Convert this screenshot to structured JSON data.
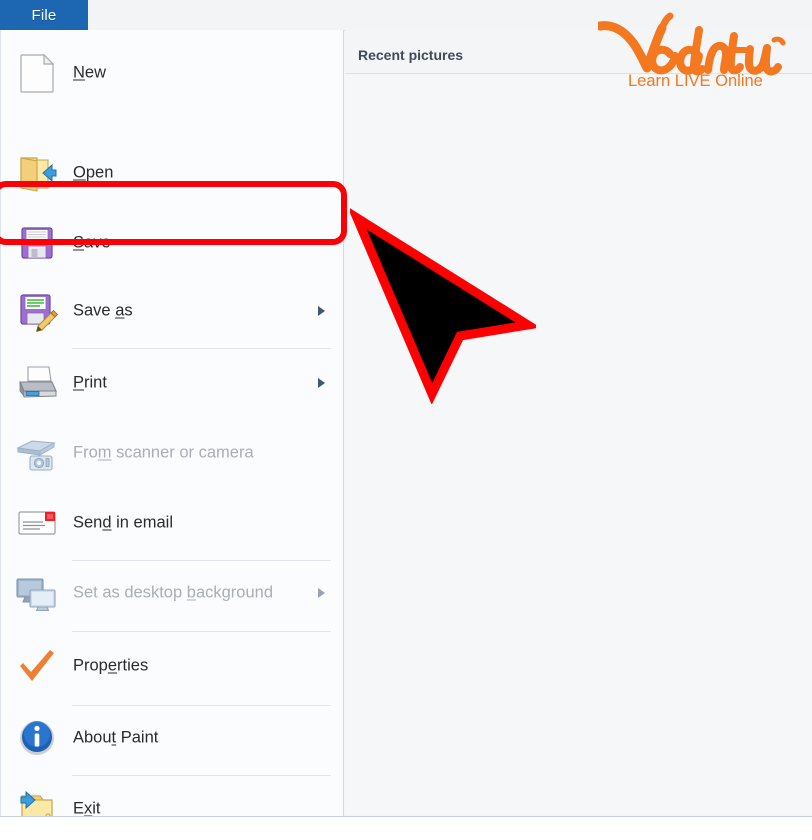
{
  "window": {
    "app_name": "Paint",
    "file_tab_label": "File"
  },
  "file_menu": {
    "items": [
      {
        "id": "new",
        "label": "New",
        "accel": "N",
        "icon": "new-document-icon",
        "disabled": false,
        "submenu": false,
        "separator_after": false
      },
      {
        "id": "open",
        "label": "Open",
        "accel": "O",
        "icon": "open-folder-icon",
        "disabled": false,
        "submenu": false,
        "separator_after": false
      },
      {
        "id": "save",
        "label": "Save",
        "accel": "S",
        "icon": "floppy-disk-icon",
        "disabled": false,
        "submenu": false,
        "separator_after": false,
        "highlighted": true
      },
      {
        "id": "save-as",
        "label": "Save as",
        "accel": "a",
        "icon": "floppy-disk-pencil-icon",
        "disabled": false,
        "submenu": true,
        "separator_after": true
      },
      {
        "id": "print",
        "label": "Print",
        "accel": "P",
        "icon": "printer-icon",
        "disabled": false,
        "submenu": true,
        "separator_after": false
      },
      {
        "id": "scanner",
        "label": "From scanner or camera",
        "accel": "m",
        "icon": "scanner-camera-icon",
        "disabled": true,
        "submenu": false,
        "separator_after": false
      },
      {
        "id": "email",
        "label": "Send in email",
        "accel": "d",
        "icon": "envelope-icon",
        "disabled": false,
        "submenu": false,
        "separator_after": true
      },
      {
        "id": "wallpaper",
        "label": "Set as desktop background",
        "accel": "b",
        "icon": "monitors-icon",
        "disabled": true,
        "submenu": true,
        "separator_after": true
      },
      {
        "id": "props",
        "label": "Properties",
        "accel": "e",
        "icon": "orange-check-icon",
        "disabled": false,
        "submenu": false,
        "separator_after": true
      },
      {
        "id": "about",
        "label": "About Paint",
        "accel": "t",
        "icon": "info-circle-icon",
        "disabled": false,
        "submenu": false,
        "separator_after": true
      },
      {
        "id": "exit",
        "label": "Exit",
        "accel": "x",
        "icon": "exit-folder-icon",
        "disabled": false,
        "submenu": false,
        "separator_after": false
      }
    ]
  },
  "recent_panel": {
    "title": "Recent pictures",
    "entries": []
  },
  "annotation": {
    "highlight_target": "Save",
    "highlight_color": "#fb0006",
    "cursor_icon": "mouse-pointer-arrow",
    "cursor_fill": "#000000",
    "cursor_outline": "#ff0000"
  },
  "branding": {
    "logo_text": "Vedantu",
    "tagline": "Learn LIVE Online",
    "brand_color": "#f4781f"
  },
  "colors": {
    "tab_accent": "#1d67b2",
    "left_pane_bg": "#fbfcfe",
    "right_pane_bg": "#f4f5f7",
    "menu_text": "#2b2b2b",
    "disabled_text": "#a9aeb6"
  }
}
